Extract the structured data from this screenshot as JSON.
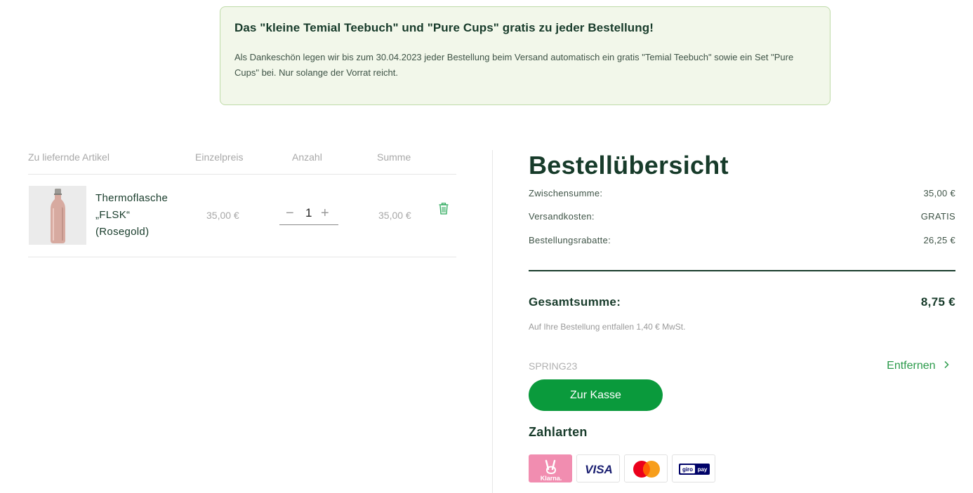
{
  "promo": {
    "title": "Das \"kleine Temial Teebuch\" und \"Pure Cups\" gratis zu jeder Bestellung!",
    "text": "Als Dankeschön legen wir bis zum 30.04.2023 jeder Bestellung beim Versand automatisch ein gratis \"Temial Teebuch\" sowie ein Set \"Pure Cups\" bei. Nur solange der Vorrat reicht."
  },
  "cart": {
    "headers": {
      "item": "Zu liefernde Artikel",
      "unit_price": "Einzelpreis",
      "quantity": "Anzahl",
      "sum": "Summe"
    },
    "items": [
      {
        "name_lines": [
          "Thermoflasche",
          "„FLSK“",
          "(Rosegold)"
        ],
        "unit_price": "35,00 €",
        "quantity": "1",
        "sum": "35,00 €"
      }
    ]
  },
  "summary": {
    "title": "Bestellübersicht",
    "subtotal_label": "Zwischensumme:",
    "subtotal_value": "35,00 €",
    "shipping_label": "Versandkosten:",
    "shipping_value": "GRATIS",
    "discount_label": "Bestellungsrabatte:",
    "discount_value": "26,25 €",
    "total_label": "Gesamtsumme:",
    "total_value": "8,75 €",
    "vat_note": "Auf Ihre Bestellung entfallen 1,40 € MwSt.",
    "coupon_code": "SPRING23",
    "remove_label": "Entfernen",
    "checkout_label": "Zur Kasse",
    "payment_title": "Zahlarten",
    "payment_methods": [
      {
        "name": "klarna-icon",
        "label": "Klarna."
      },
      {
        "name": "visa-icon",
        "label": "VISA"
      },
      {
        "name": "mastercard-icon",
        "label": ""
      },
      {
        "name": "giropay-icon",
        "label": "giropay"
      }
    ]
  },
  "colors": {
    "brand_dark": "#173b2a",
    "accent_green": "#0a9a3c",
    "promo_bg": "#f2f7ea",
    "klarna_pink": "#f18db0"
  }
}
